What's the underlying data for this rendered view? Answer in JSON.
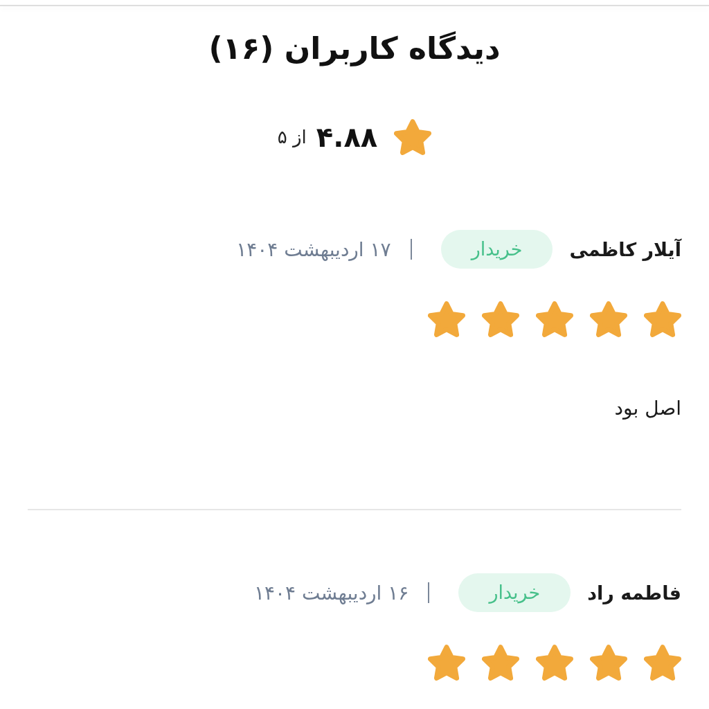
{
  "header": {
    "title": "دیدگاه کاربران (۱۶)"
  },
  "rating": {
    "score": "۴.۸۸",
    "out_of": "از ۵"
  },
  "reviews": [
    {
      "name": "آیلار کاظمی",
      "badge": "خریدار",
      "date": "۱۷ اردیبهشت ۱۴۰۴",
      "stars": 5,
      "comment": "اصل بود"
    },
    {
      "name": "فاطمه راد",
      "badge": "خریدار",
      "date": "۱۶ اردیبهشت ۱۴۰۴",
      "stars": 5
    }
  ]
}
